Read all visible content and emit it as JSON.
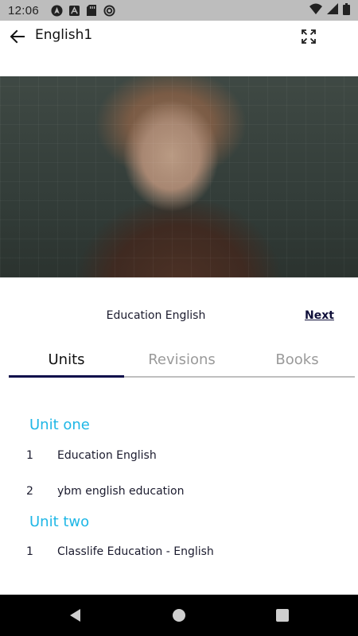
{
  "status_bar": {
    "time": "12:06",
    "icons": [
      "navigation-icon",
      "app-notification-icon",
      "sd-card-icon",
      "sync-icon",
      "wifi-icon",
      "signal-icon",
      "battery-icon"
    ]
  },
  "app_bar": {
    "title": "English1",
    "back_icon": "arrow-left-icon",
    "fullscreen_icon": "fullscreen-icon"
  },
  "video": {
    "description_icon": "video-frame"
  },
  "course": {
    "title": "Education English",
    "next_label": "Next"
  },
  "tabs": [
    {
      "label": "Units",
      "active": true
    },
    {
      "label": "Revisions",
      "active": false
    },
    {
      "label": "Books",
      "active": false
    }
  ],
  "units": [
    {
      "name": "Unit one",
      "lessons": [
        {
          "number": "1",
          "title": "Education English"
        },
        {
          "number": "2",
          "title": "ybm english education"
        }
      ]
    },
    {
      "name": "Unit two",
      "lessons": [
        {
          "number": "1",
          "title": "Classlife Education - English"
        }
      ]
    }
  ],
  "colors": {
    "accent": "#1fb7e6",
    "tab_indicator": "#0b0b4a",
    "status_bar": "#bdbdbd",
    "nav_bar": "#000000"
  },
  "nav_bar": {
    "icons": [
      "back-triangle-icon",
      "home-circle-icon",
      "recents-square-icon"
    ]
  }
}
